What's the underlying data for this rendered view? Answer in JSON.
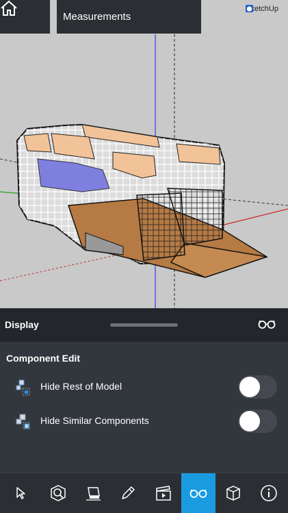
{
  "header": {
    "title": "Measurements",
    "brand": "SketchUp"
  },
  "display": {
    "title": "Display"
  },
  "component_edit": {
    "title": "Component Edit",
    "options": [
      {
        "label": "Hide Rest of Model",
        "enabled": false,
        "icon": "component-hide-rest-icon"
      },
      {
        "label": "Hide Similar Components",
        "enabled": false,
        "icon": "component-hide-similar-icon"
      }
    ]
  },
  "toolbar": {
    "items": [
      {
        "name": "select-tool",
        "icon": "cursor-icon"
      },
      {
        "name": "search-model-tool",
        "icon": "magnify-icon"
      },
      {
        "name": "eraser-tool",
        "icon": "eraser-icon"
      },
      {
        "name": "draw-tool",
        "icon": "pencil-icon"
      },
      {
        "name": "scenes-tool",
        "icon": "clapper-icon"
      },
      {
        "name": "display-tool",
        "icon": "glasses-icon",
        "active": true
      },
      {
        "name": "components-tool",
        "icon": "cube-icon"
      },
      {
        "name": "info-tool",
        "icon": "info-icon"
      }
    ]
  },
  "colors": {
    "accent": "#1a9be0",
    "panel": "#32373d",
    "viewport": "#c9c9c9"
  }
}
